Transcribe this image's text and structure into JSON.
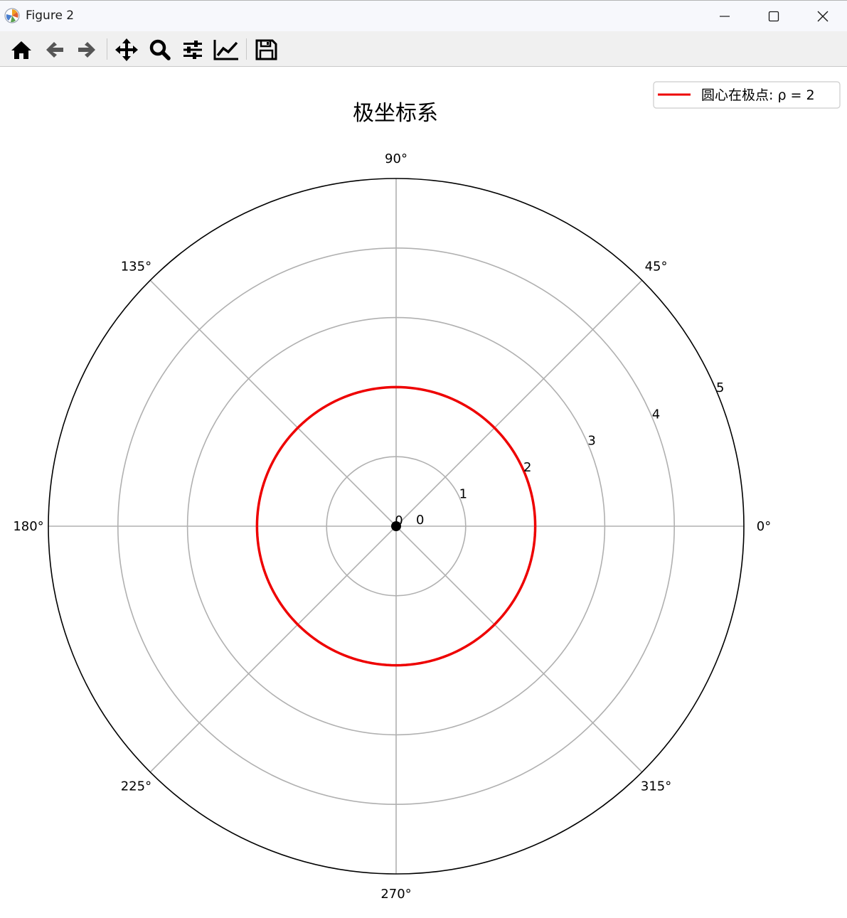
{
  "window": {
    "title": "Figure 2",
    "controls": [
      "minimize-icon",
      "maximize-icon",
      "close-icon"
    ]
  },
  "toolbar": {
    "items": [
      "home-icon",
      "back-arrow-icon",
      "forward-arrow-icon",
      "pan-icon",
      "zoom-icon",
      "configure-subplots-icon",
      "edit-axis-icon",
      "save-icon"
    ]
  },
  "chart_data": {
    "type": "line",
    "projection": "polar",
    "title": "极坐标系",
    "theta_ticks": [
      {
        "deg": 0,
        "label": "0°"
      },
      {
        "deg": 45,
        "label": "45°"
      },
      {
        "deg": 90,
        "label": "90°"
      },
      {
        "deg": 135,
        "label": "135°"
      },
      {
        "deg": 180,
        "label": "180°"
      },
      {
        "deg": 225,
        "label": "225°"
      },
      {
        "deg": 270,
        "label": "270°"
      },
      {
        "deg": 315,
        "label": "315°"
      }
    ],
    "r_ticks": [
      {
        "value": 0,
        "label": "0"
      },
      {
        "value": 1,
        "label": "1"
      },
      {
        "value": 2,
        "label": "2"
      },
      {
        "value": 3,
        "label": "3"
      },
      {
        "value": 4,
        "label": "4"
      },
      {
        "value": 5,
        "label": "5"
      }
    ],
    "rlim": [
      0,
      5
    ],
    "rlabel_position_deg": 22.5,
    "grid": true,
    "series": [
      {
        "name": "圆心在极点: ρ = 2",
        "type": "line",
        "r_constant": 2,
        "theta_range_deg": [
          0,
          360
        ],
        "color": "#ee0000"
      }
    ],
    "points": [
      {
        "r": 0,
        "theta_deg": 0,
        "label": "0",
        "color": "#000000"
      }
    ],
    "legend": {
      "placement": "top-right",
      "entries": [
        "圆心在极点: ρ = 2"
      ]
    }
  }
}
